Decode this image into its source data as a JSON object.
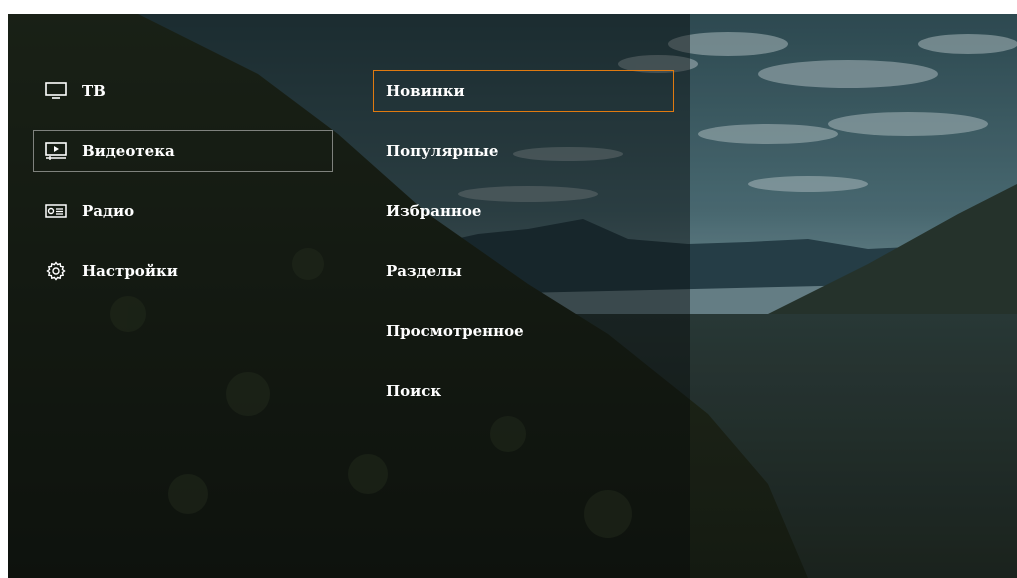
{
  "colors": {
    "focus_border": "#e07a10",
    "selected_border": "rgba(255,255,255,0.45)",
    "text": "#ffffff"
  },
  "nav": {
    "items": [
      {
        "label": "ТВ",
        "icon": "tv-icon"
      },
      {
        "label": "Видеотека",
        "icon": "video-library-icon"
      },
      {
        "label": "Радио",
        "icon": "radio-icon"
      },
      {
        "label": "Настройки",
        "icon": "gear-icon"
      }
    ],
    "selected": "Видеотека"
  },
  "submenu": {
    "items": [
      {
        "label": "Новинки"
      },
      {
        "label": "Популярные"
      },
      {
        "label": "Избранное"
      },
      {
        "label": "Разделы"
      },
      {
        "label": "Просмотренное"
      },
      {
        "label": "Поиск"
      }
    ],
    "focused": "Новинки"
  }
}
